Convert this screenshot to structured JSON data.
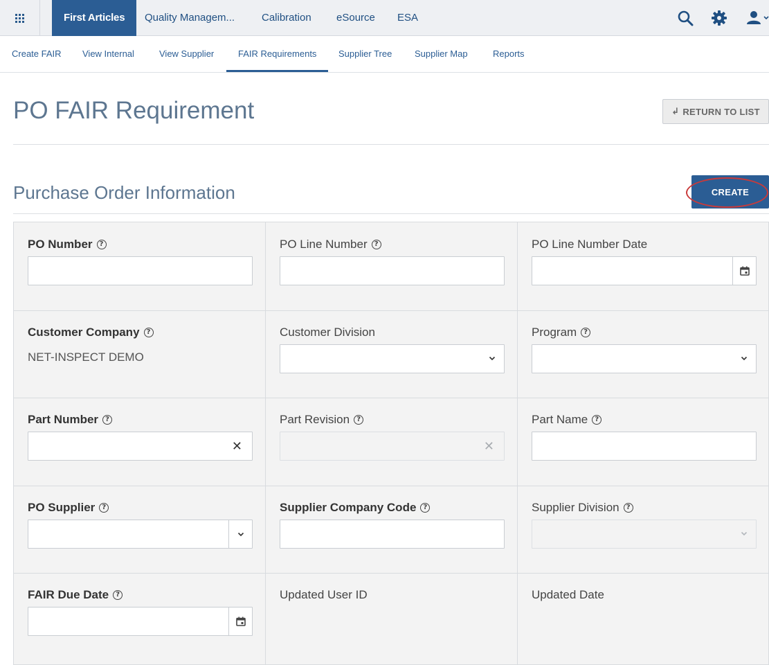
{
  "topnav": {
    "tabs": [
      {
        "label": "First Articles",
        "active": true
      },
      {
        "label": "Quality Managem...",
        "active": false
      },
      {
        "label": "Calibration",
        "active": false
      },
      {
        "label": "eSource",
        "active": false
      },
      {
        "label": "ESA",
        "active": false
      }
    ],
    "icons": [
      "apps-grid-icon",
      "search-icon",
      "gear-icon",
      "user-icon"
    ]
  },
  "subnav": {
    "items": [
      {
        "label": "Create FAIR"
      },
      {
        "label": "View Internal"
      },
      {
        "label": "View Supplier"
      },
      {
        "label": "FAIR Requirements",
        "active": true
      },
      {
        "label": "Supplier Tree"
      },
      {
        "label": "Supplier Map"
      },
      {
        "label": "Reports"
      }
    ]
  },
  "page": {
    "title": "PO FAIR Requirement",
    "return_label": "RETURN TO LIST",
    "return_glyph": "↲",
    "section_title": "Purchase Order Information",
    "create_label": "CREATE"
  },
  "form": {
    "po_number": {
      "label": "PO Number",
      "value": ""
    },
    "po_line_number": {
      "label": "PO Line Number",
      "value": ""
    },
    "po_line_number_date": {
      "label": "PO Line Number Date",
      "value": ""
    },
    "customer_company": {
      "label": "Customer Company",
      "value": "NET-INSPECT DEMO"
    },
    "customer_division": {
      "label": "Customer Division",
      "value": ""
    },
    "program": {
      "label": "Program",
      "value": ""
    },
    "part_number": {
      "label": "Part Number",
      "value": ""
    },
    "part_revision": {
      "label": "Part Revision",
      "value": ""
    },
    "part_name": {
      "label": "Part Name",
      "value": ""
    },
    "po_supplier": {
      "label": "PO Supplier",
      "value": ""
    },
    "supplier_company_code": {
      "label": "Supplier Company Code",
      "value": ""
    },
    "supplier_division": {
      "label": "Supplier Division",
      "value": ""
    },
    "fair_due_date": {
      "label": "FAIR Due Date",
      "value": ""
    },
    "updated_user_id": {
      "label": "Updated User ID",
      "value": ""
    },
    "updated_date": {
      "label": "Updated Date",
      "value": ""
    }
  },
  "colors": {
    "primary": "#2b5d94",
    "heading": "#5d7690",
    "highlight_ring": "#c93a3a"
  }
}
